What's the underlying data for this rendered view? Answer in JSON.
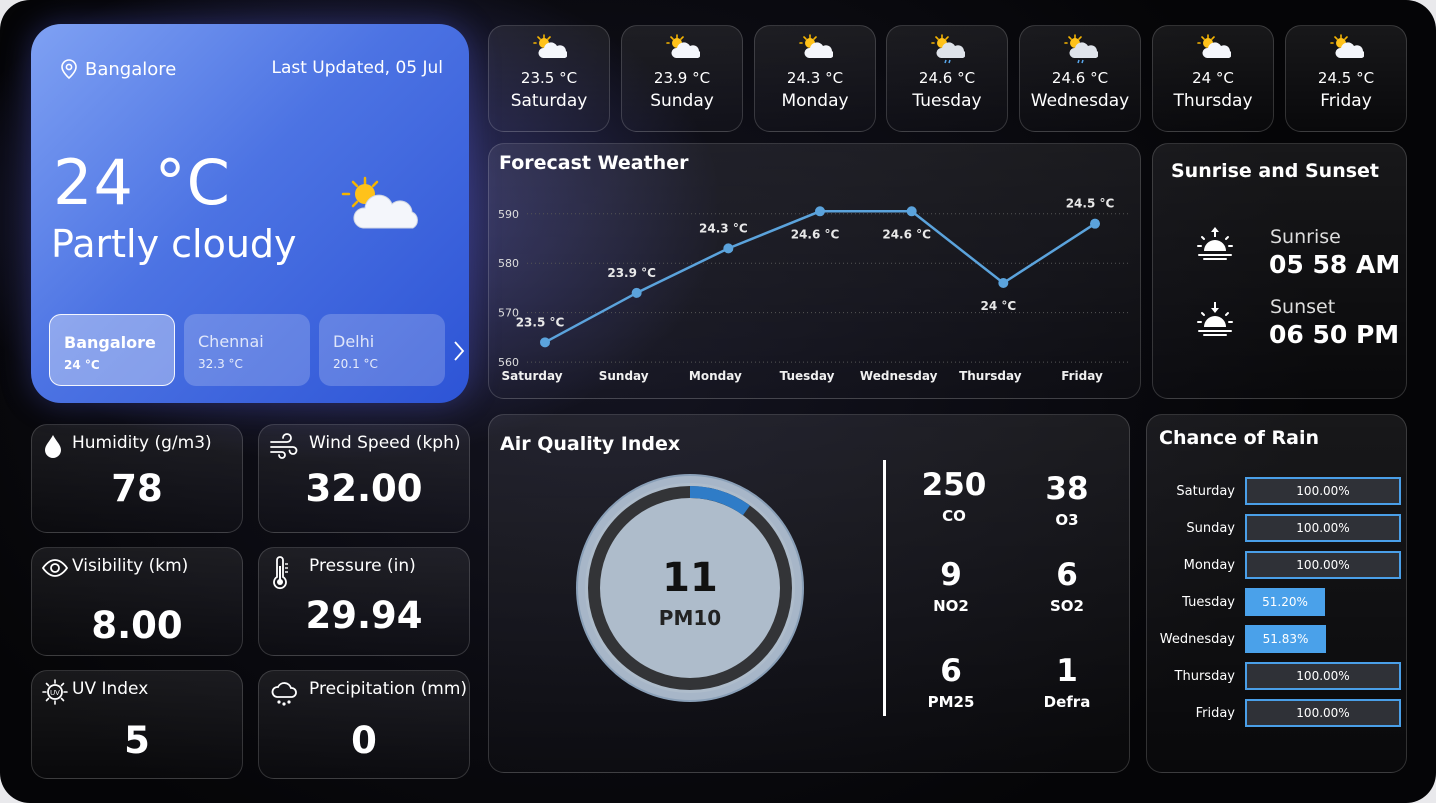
{
  "current": {
    "location": "Bangalore",
    "updated": "Last Updated, 05 Jul",
    "temp": "24 °C",
    "condition": "Partly cloudy"
  },
  "cities": [
    {
      "name": "Bangalore",
      "temp": "24 °C"
    },
    {
      "name": "Chennai",
      "temp": "32.3 °C"
    },
    {
      "name": "Delhi",
      "temp": "20.1 °C"
    }
  ],
  "daily": [
    {
      "temp": "23.5 °C",
      "day": "Saturday",
      "icon": "partly-sunny-icon"
    },
    {
      "temp": "23.9 °C",
      "day": "Sunday",
      "icon": "partly-sunny-icon"
    },
    {
      "temp": "24.3 °C",
      "day": "Monday",
      "icon": "partly-sunny-icon"
    },
    {
      "temp": "24.6 °C",
      "day": "Tuesday",
      "icon": "sun-rain-icon"
    },
    {
      "temp": "24.6 °C",
      "day": "Wednesday",
      "icon": "sun-rain-icon"
    },
    {
      "temp": "24 °C",
      "day": "Thursday",
      "icon": "partly-sunny-icon"
    },
    {
      "temp": "24.5 °C",
      "day": "Friday",
      "icon": "partly-sunny-icon"
    }
  ],
  "metrics": {
    "humidity": {
      "label": "Humidity (g/m3)",
      "value": "78"
    },
    "wind": {
      "label": "Wind Speed (kph)",
      "value": "32.00"
    },
    "visibility": {
      "label": "Visibility (km)",
      "value": "8.00"
    },
    "pressure": {
      "label": "Pressure (in)",
      "value": "29.94"
    },
    "uv": {
      "label": "UV Index",
      "value": "5"
    },
    "precip": {
      "label": "Precipitation (mm)",
      "value": "0"
    }
  },
  "forecast_title": "Forecast Weather",
  "chart_data": {
    "type": "line",
    "title": "Forecast Weather",
    "categories": [
      "Saturday",
      "Sunday",
      "Monday",
      "Tuesday",
      "Wednesday",
      "Thursday",
      "Friday"
    ],
    "values": [
      564,
      574,
      583,
      590.5,
      590.5,
      576,
      588
    ],
    "labels": [
      "23.5 °C",
      "23.9 °C",
      "24.3 °C",
      "24.6 °C",
      "24.6 °C",
      "24 °C",
      "24.5 °C"
    ],
    "yticks": [
      560,
      570,
      580,
      590
    ],
    "ylim": [
      558,
      594
    ],
    "grid": true,
    "color": "#5ba3dc"
  },
  "sun": {
    "title": "Sunrise and Sunset",
    "sunrise_label": "Sunrise",
    "sunrise": "05 58 AM",
    "sunset_label": "Sunset",
    "sunset": "06 50 PM"
  },
  "aqi": {
    "title": "Air Quality Index",
    "value": "11",
    "pollutant": "PM10",
    "gauge_fraction": 0.1,
    "items": [
      {
        "v": "250",
        "k": "CO"
      },
      {
        "v": "38",
        "k": "O3"
      },
      {
        "v": "9",
        "k": "NO2"
      },
      {
        "v": "6",
        "k": "SO2"
      },
      {
        "v": "6",
        "k": "PM25"
      },
      {
        "v": "1",
        "k": "Defra"
      }
    ]
  },
  "rain": {
    "title": "Chance of Rain",
    "rows": [
      {
        "day": "Saturday",
        "pct": "100.00%",
        "frac": 1.0
      },
      {
        "day": "Sunday",
        "pct": "100.00%",
        "frac": 1.0
      },
      {
        "day": "Monday",
        "pct": "100.00%",
        "frac": 1.0
      },
      {
        "day": "Tuesday",
        "pct": "51.20%",
        "frac": 0.512
      },
      {
        "day": "Wednesday",
        "pct": "51.83%",
        "frac": 0.5183
      },
      {
        "day": "Thursday",
        "pct": "100.00%",
        "frac": 1.0
      },
      {
        "day": "Friday",
        "pct": "100.00%",
        "frac": 1.0
      }
    ]
  }
}
